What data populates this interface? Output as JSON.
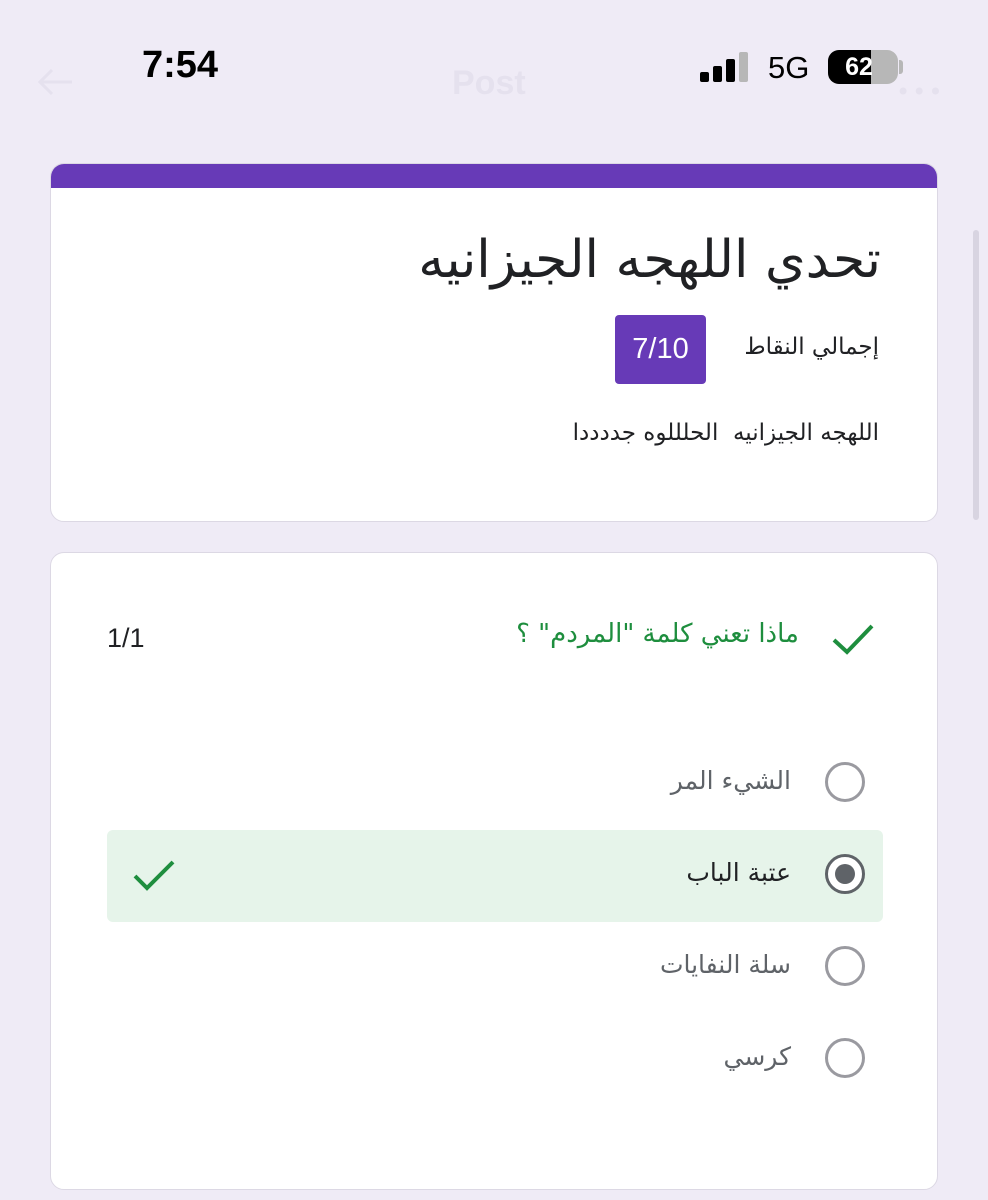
{
  "status_bar": {
    "time": "7:54",
    "network": "5G",
    "battery_level": "62",
    "battery_fraction": 0.62,
    "background_title": "Post"
  },
  "form": {
    "title": "تحدي اللهجه الجيزانيه",
    "score_label": "إجمالي النقاط",
    "score": "7/10",
    "description": "اللهجه الجيزانيه  الحلللوه جددددا",
    "accent_color": "#673ab7"
  },
  "question": {
    "text": "ماذا تعني كلمة \"المردم\" ؟",
    "points": "1/1",
    "status": "correct",
    "options": [
      {
        "label": "الشيء المر",
        "selected": false,
        "correct": false
      },
      {
        "label": "عتبة الباب",
        "selected": true,
        "correct": true
      },
      {
        "label": "سلة النفايات",
        "selected": false,
        "correct": false
      },
      {
        "label": "كرسي",
        "selected": false,
        "correct": false
      }
    ],
    "correct_color": "#1e8e3e",
    "correct_bg": "#e6f4ea"
  },
  "icons": {
    "back": "back-arrow-icon",
    "more": "more-icon",
    "signal": "signal-icon",
    "battery": "battery-icon",
    "check": "check-icon",
    "radio": "radio-icon"
  }
}
